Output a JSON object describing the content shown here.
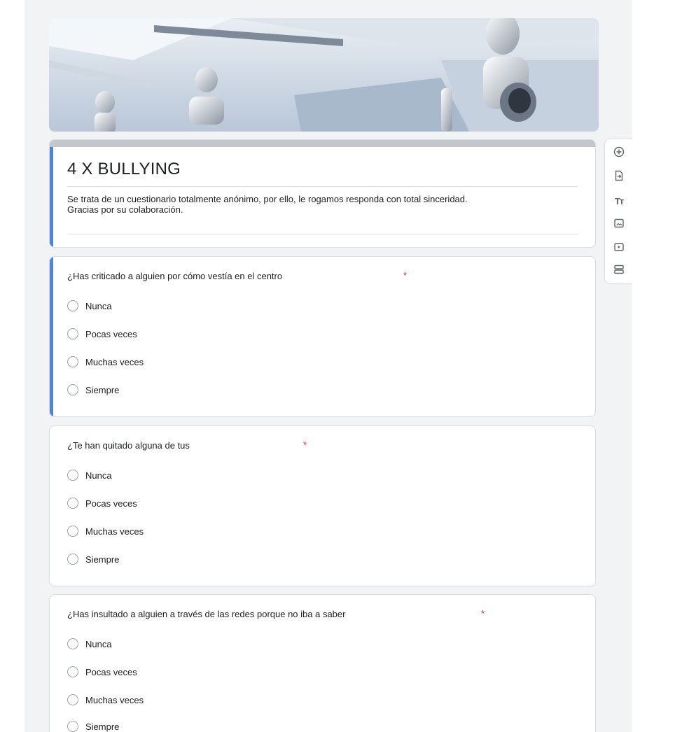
{
  "form": {
    "title": "4 X BULLYING",
    "description_line1": "Se trata de un cuestionario totalmente anónimo, por ello, le rogamos responda con total sinceridad.",
    "description_line2": "Gracias por su colaboración."
  },
  "questions": [
    {
      "text": "¿Has criticado a alguien por cómo vestía en el centro",
      "required_mark": "*",
      "options": [
        "Nunca",
        "Pocas veces",
        "Muchas veces",
        "Siempre"
      ]
    },
    {
      "text": "¿Te han quitado alguna de tus",
      "required_mark": "*",
      "options": [
        "Nunca",
        "Pocas veces",
        "Muchas veces",
        "Siempre"
      ]
    },
    {
      "text": "¿Has insultado a alguien a través de las redes porque no iba a saber",
      "required_mark": "*",
      "options": [
        "Nunca",
        "Pocas veces",
        "Muchas veces",
        "Siempre"
      ]
    }
  ],
  "toolbar": {
    "items": [
      {
        "icon": "add-question-icon"
      },
      {
        "icon": "import-questions-icon"
      },
      {
        "icon": "add-title-icon",
        "glyph": "Tт"
      },
      {
        "icon": "add-image-icon"
      },
      {
        "icon": "add-video-icon"
      },
      {
        "icon": "add-section-icon"
      }
    ]
  },
  "colors": {
    "accent": "#4285f4",
    "required": "#d93025",
    "header_bar": "#c1c7cd"
  }
}
